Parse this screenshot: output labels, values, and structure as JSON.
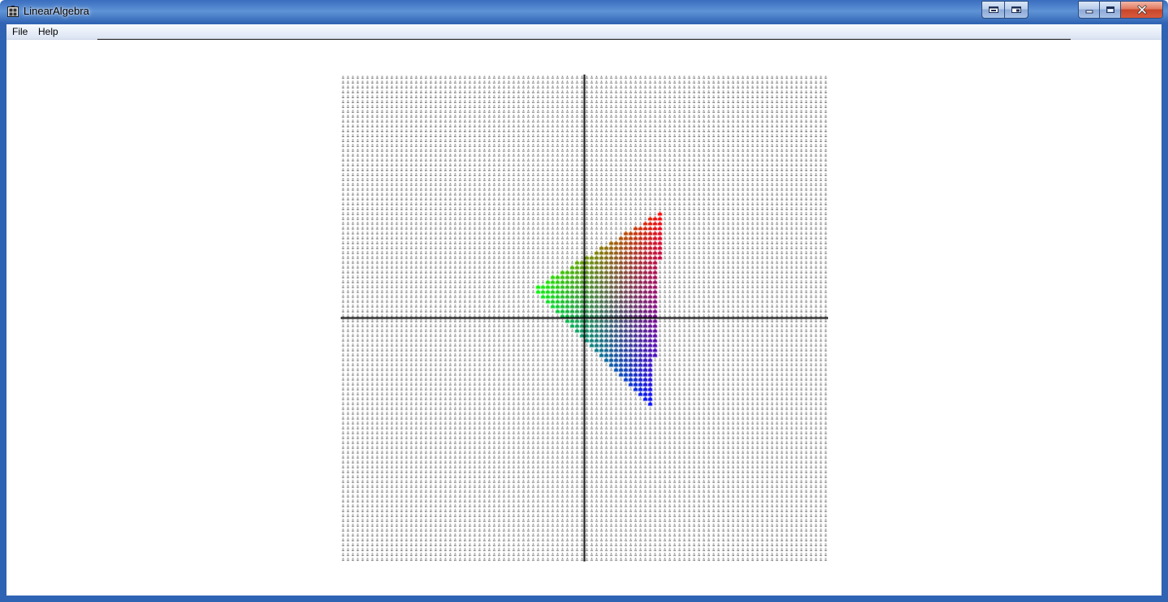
{
  "window": {
    "title": "LinearAlgebra",
    "icon": "app-grid-icon"
  },
  "caption_buttons": {
    "extra": [
      "restore-window-icon",
      "tile-window-icon"
    ],
    "standard": [
      "minimize-icon",
      "maximize-icon",
      "close-icon"
    ]
  },
  "menu": {
    "items": [
      {
        "label": "File"
      },
      {
        "label": "Help"
      }
    ]
  },
  "canvas": {
    "description_type": "transformed-triangle-grid",
    "background": "#ffffff",
    "grid_dot_color": "#000000",
    "axis_color": "#000000",
    "x_range": [
      -50,
      50
    ],
    "y_range": [
      -50,
      50
    ],
    "triangle_vertices": [
      [
        -11,
        6
      ],
      [
        16,
        22
      ],
      [
        14,
        -18
      ]
    ],
    "vertex_colors": {
      "left": "#00ff00",
      "top": "#ff0000",
      "bottom": "#0000ff"
    }
  }
}
